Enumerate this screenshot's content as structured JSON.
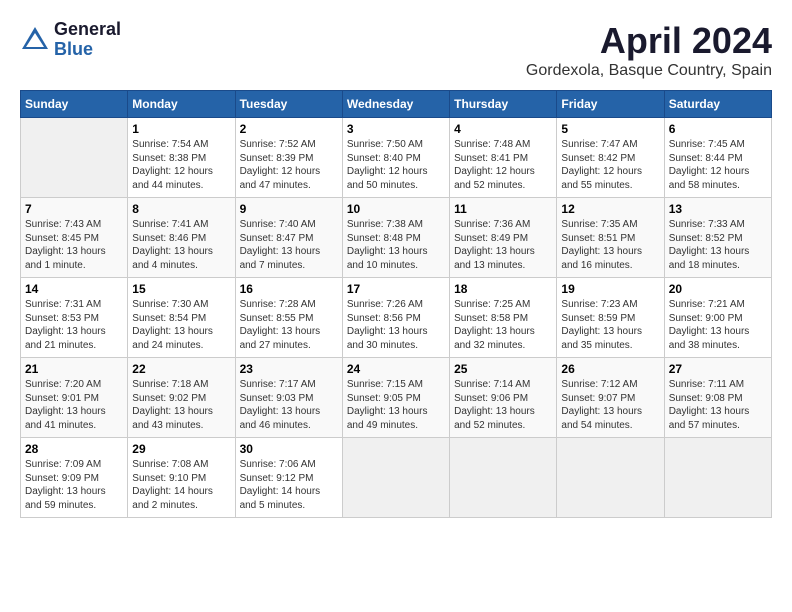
{
  "header": {
    "logo_general": "General",
    "logo_blue": "Blue",
    "title": "April 2024",
    "location": "Gordexola, Basque Country, Spain"
  },
  "weekdays": [
    "Sunday",
    "Monday",
    "Tuesday",
    "Wednesday",
    "Thursday",
    "Friday",
    "Saturday"
  ],
  "weeks": [
    [
      {
        "day": "",
        "content": ""
      },
      {
        "day": "1",
        "content": "Sunrise: 7:54 AM\nSunset: 8:38 PM\nDaylight: 12 hours\nand 44 minutes."
      },
      {
        "day": "2",
        "content": "Sunrise: 7:52 AM\nSunset: 8:39 PM\nDaylight: 12 hours\nand 47 minutes."
      },
      {
        "day": "3",
        "content": "Sunrise: 7:50 AM\nSunset: 8:40 PM\nDaylight: 12 hours\nand 50 minutes."
      },
      {
        "day": "4",
        "content": "Sunrise: 7:48 AM\nSunset: 8:41 PM\nDaylight: 12 hours\nand 52 minutes."
      },
      {
        "day": "5",
        "content": "Sunrise: 7:47 AM\nSunset: 8:42 PM\nDaylight: 12 hours\nand 55 minutes."
      },
      {
        "day": "6",
        "content": "Sunrise: 7:45 AM\nSunset: 8:44 PM\nDaylight: 12 hours\nand 58 minutes."
      }
    ],
    [
      {
        "day": "7",
        "content": "Sunrise: 7:43 AM\nSunset: 8:45 PM\nDaylight: 13 hours\nand 1 minute."
      },
      {
        "day": "8",
        "content": "Sunrise: 7:41 AM\nSunset: 8:46 PM\nDaylight: 13 hours\nand 4 minutes."
      },
      {
        "day": "9",
        "content": "Sunrise: 7:40 AM\nSunset: 8:47 PM\nDaylight: 13 hours\nand 7 minutes."
      },
      {
        "day": "10",
        "content": "Sunrise: 7:38 AM\nSunset: 8:48 PM\nDaylight: 13 hours\nand 10 minutes."
      },
      {
        "day": "11",
        "content": "Sunrise: 7:36 AM\nSunset: 8:49 PM\nDaylight: 13 hours\nand 13 minutes."
      },
      {
        "day": "12",
        "content": "Sunrise: 7:35 AM\nSunset: 8:51 PM\nDaylight: 13 hours\nand 16 minutes."
      },
      {
        "day": "13",
        "content": "Sunrise: 7:33 AM\nSunset: 8:52 PM\nDaylight: 13 hours\nand 18 minutes."
      }
    ],
    [
      {
        "day": "14",
        "content": "Sunrise: 7:31 AM\nSunset: 8:53 PM\nDaylight: 13 hours\nand 21 minutes."
      },
      {
        "day": "15",
        "content": "Sunrise: 7:30 AM\nSunset: 8:54 PM\nDaylight: 13 hours\nand 24 minutes."
      },
      {
        "day": "16",
        "content": "Sunrise: 7:28 AM\nSunset: 8:55 PM\nDaylight: 13 hours\nand 27 minutes."
      },
      {
        "day": "17",
        "content": "Sunrise: 7:26 AM\nSunset: 8:56 PM\nDaylight: 13 hours\nand 30 minutes."
      },
      {
        "day": "18",
        "content": "Sunrise: 7:25 AM\nSunset: 8:58 PM\nDaylight: 13 hours\nand 32 minutes."
      },
      {
        "day": "19",
        "content": "Sunrise: 7:23 AM\nSunset: 8:59 PM\nDaylight: 13 hours\nand 35 minutes."
      },
      {
        "day": "20",
        "content": "Sunrise: 7:21 AM\nSunset: 9:00 PM\nDaylight: 13 hours\nand 38 minutes."
      }
    ],
    [
      {
        "day": "21",
        "content": "Sunrise: 7:20 AM\nSunset: 9:01 PM\nDaylight: 13 hours\nand 41 minutes."
      },
      {
        "day": "22",
        "content": "Sunrise: 7:18 AM\nSunset: 9:02 PM\nDaylight: 13 hours\nand 43 minutes."
      },
      {
        "day": "23",
        "content": "Sunrise: 7:17 AM\nSunset: 9:03 PM\nDaylight: 13 hours\nand 46 minutes."
      },
      {
        "day": "24",
        "content": "Sunrise: 7:15 AM\nSunset: 9:05 PM\nDaylight: 13 hours\nand 49 minutes."
      },
      {
        "day": "25",
        "content": "Sunrise: 7:14 AM\nSunset: 9:06 PM\nDaylight: 13 hours\nand 52 minutes."
      },
      {
        "day": "26",
        "content": "Sunrise: 7:12 AM\nSunset: 9:07 PM\nDaylight: 13 hours\nand 54 minutes."
      },
      {
        "day": "27",
        "content": "Sunrise: 7:11 AM\nSunset: 9:08 PM\nDaylight: 13 hours\nand 57 minutes."
      }
    ],
    [
      {
        "day": "28",
        "content": "Sunrise: 7:09 AM\nSunset: 9:09 PM\nDaylight: 13 hours\nand 59 minutes."
      },
      {
        "day": "29",
        "content": "Sunrise: 7:08 AM\nSunset: 9:10 PM\nDaylight: 14 hours\nand 2 minutes."
      },
      {
        "day": "30",
        "content": "Sunrise: 7:06 AM\nSunset: 9:12 PM\nDaylight: 14 hours\nand 5 minutes."
      },
      {
        "day": "",
        "content": ""
      },
      {
        "day": "",
        "content": ""
      },
      {
        "day": "",
        "content": ""
      },
      {
        "day": "",
        "content": ""
      }
    ]
  ]
}
